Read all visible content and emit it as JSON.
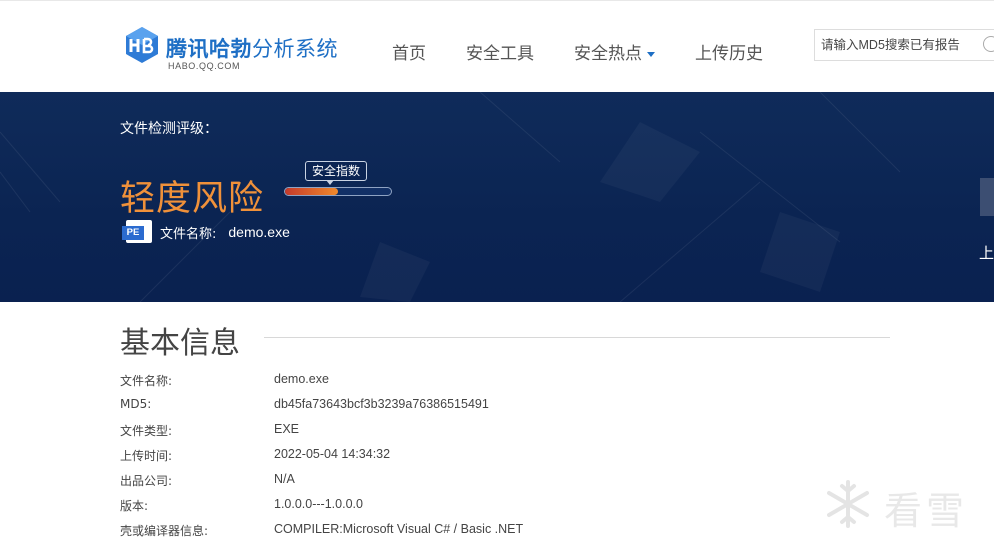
{
  "header": {
    "logo": {
      "title_bold": "腾讯哈勃",
      "title_rest": "分析系统",
      "subtitle": "HABO.QQ.COM"
    },
    "nav": [
      {
        "label": "首页"
      },
      {
        "label": "安全工具"
      },
      {
        "label": "安全热点",
        "has_dropdown": true
      },
      {
        "label": "上传历史"
      }
    ],
    "search": {
      "placeholder": "请输入MD5搜索已有报告",
      "value": ""
    }
  },
  "banner": {
    "rating_label": "文件检测评级：",
    "risk_level": "轻度风险",
    "score_tooltip": "安全指数",
    "score_fraction": 0.5,
    "file_label": "文件名称:",
    "file_name": "demo.exe",
    "file_icon_text": "PE",
    "side_text": "上"
  },
  "basic_info": {
    "title": "基本信息",
    "rows": [
      {
        "key": "文件名称:",
        "value": "demo.exe"
      },
      {
        "key": "MD5:",
        "value": "db45fa73643bcf3b3239a76386515491"
      },
      {
        "key": "文件类型:",
        "value": "EXE"
      },
      {
        "key": "上传时间:",
        "value": "2022-05-04 14:34:32"
      },
      {
        "key": "出品公司:",
        "value": "N/A"
      },
      {
        "key": "版本:",
        "value": "1.0.0.0---1.0.0.0"
      },
      {
        "key": "壳或编译器信息:",
        "value": "COMPILER:Microsoft Visual C# / Basic .NET"
      }
    ]
  },
  "watermark": {
    "text": "看雪"
  },
  "colors": {
    "brand": "#1e6fc5",
    "banner_bg": "#0b2452",
    "risk": "#f0913a"
  }
}
